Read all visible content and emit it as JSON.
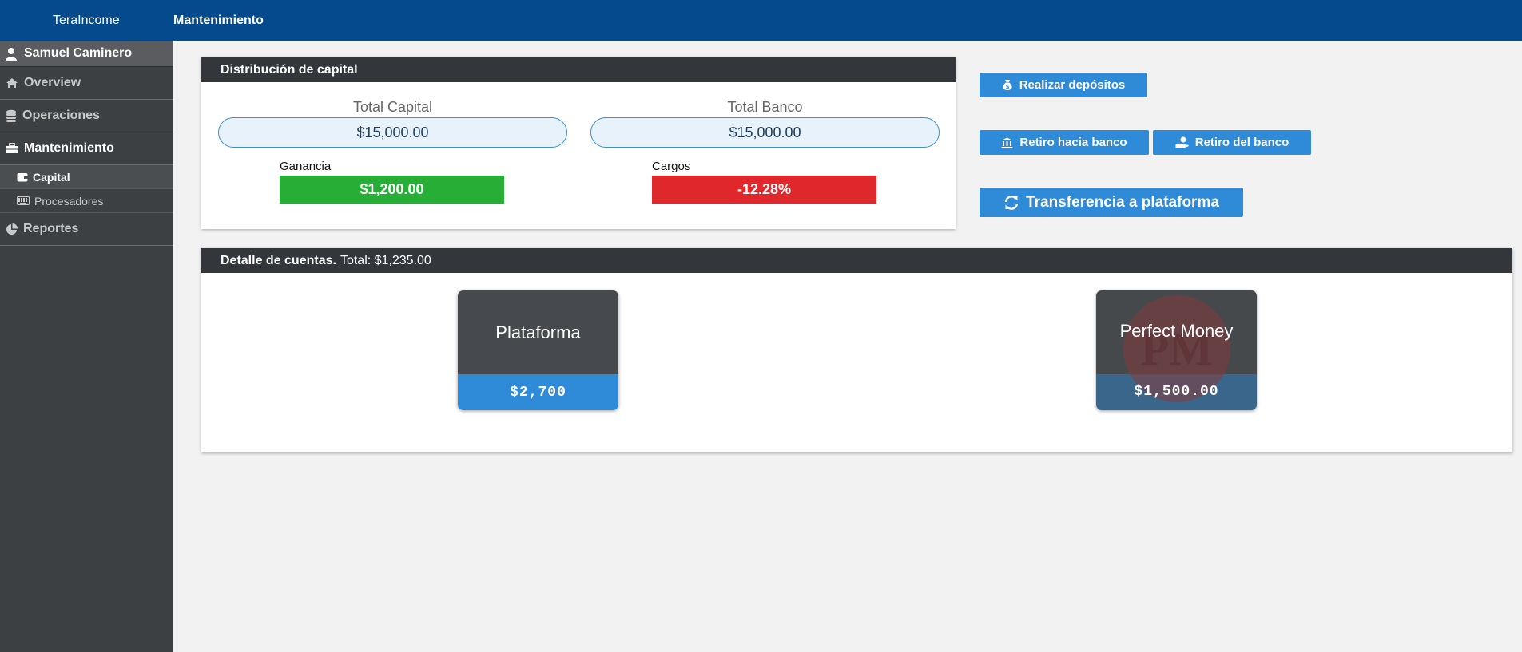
{
  "topbar": {
    "brand": "TeraIncome",
    "section": "Mantenimiento"
  },
  "sidebar": {
    "user": "Samuel Caminero",
    "items": [
      {
        "label": "Overview",
        "icon": "home-icon"
      },
      {
        "label": "Operaciones",
        "icon": "coins-icon"
      },
      {
        "label": "Mantenimiento",
        "icon": "toolbox-icon"
      },
      {
        "label": "Reportes",
        "icon": "pie-chart-icon"
      }
    ],
    "subitems": [
      {
        "label": "Capital",
        "icon": "wallet-icon"
      },
      {
        "label": "Procesadores",
        "icon": "keyboard-icon"
      }
    ]
  },
  "distribucion": {
    "title": "Distribución de capital",
    "total_capital_label": "Total Capital",
    "total_capital_value": "$15,000.00",
    "total_banco_label": "Total Banco",
    "total_banco_value": "$15,000.00",
    "ganancia_label": "Ganancia",
    "ganancia_value": "$1,200.00",
    "cargos_label": "Cargos",
    "cargos_value": "-12.28%"
  },
  "actions": {
    "deposit": "Realizar depósitos",
    "withdraw_to_bank": "Retiro hacia banco",
    "withdraw_from_bank": "Retiro del banco",
    "transfer": "Transferencia a plataforma"
  },
  "detalle": {
    "title": "Detalle de cuentas.",
    "total": "Total: $1,235.00",
    "cards": [
      {
        "name": "Plataforma",
        "amount": "$2,700"
      },
      {
        "name": "Perfect Money",
        "amount": "$1,500.00",
        "logo": "PM"
      }
    ]
  },
  "colors": {
    "topbar": "#044a8c",
    "sidebar": "#3c4043",
    "accent": "#2f8ad8",
    "ganancia": "#27ae36",
    "cargos": "#e0282c"
  }
}
